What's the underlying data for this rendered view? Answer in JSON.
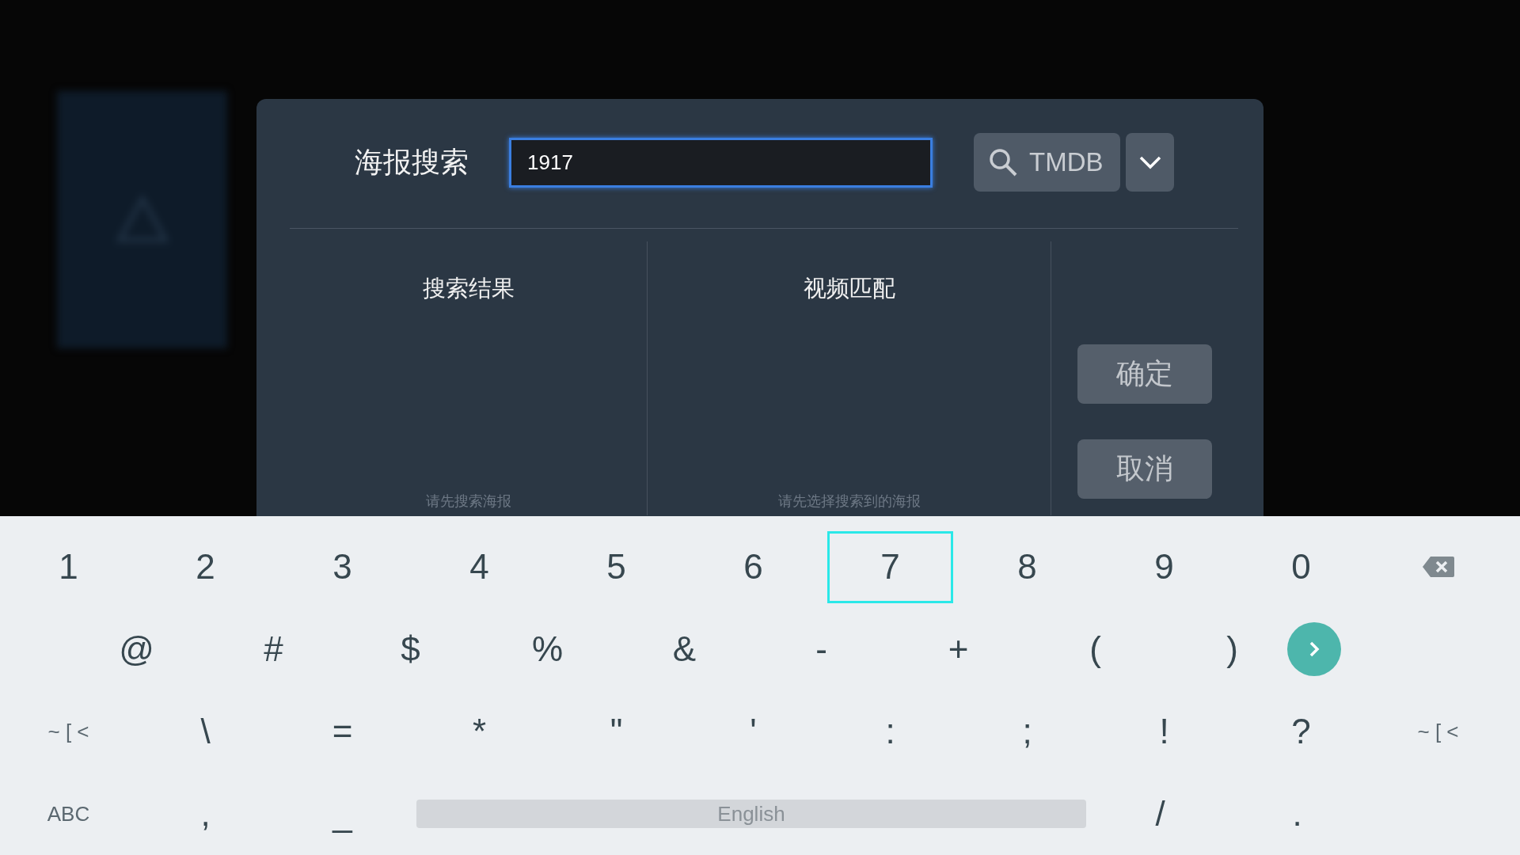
{
  "dialog": {
    "title": "海报搜索",
    "search": {
      "value": "1917"
    },
    "source_button": {
      "label": "TMDB"
    },
    "columns": [
      {
        "heading": "搜索结果",
        "hint": "请先搜索海报"
      },
      {
        "heading": "视频匹配",
        "hint": "请先选择搜索到的海报"
      }
    ],
    "buttons": [
      "确定",
      "取消"
    ]
  },
  "keyboard": {
    "rows": [
      {
        "keys": [
          {
            "kind": "char",
            "label": "1",
            "selected": false
          },
          {
            "kind": "char",
            "label": "2",
            "selected": false
          },
          {
            "kind": "char",
            "label": "3",
            "selected": false
          },
          {
            "kind": "char",
            "label": "4",
            "selected": false
          },
          {
            "kind": "char",
            "label": "5",
            "selected": false
          },
          {
            "kind": "char",
            "label": "6",
            "selected": false
          },
          {
            "kind": "char",
            "label": "7",
            "selected": true
          },
          {
            "kind": "char",
            "label": "8",
            "selected": false
          },
          {
            "kind": "char",
            "label": "9",
            "selected": false
          },
          {
            "kind": "char",
            "label": "0",
            "selected": false
          },
          {
            "kind": "backspace",
            "selected": false
          }
        ]
      },
      {
        "keys": [
          {
            "kind": "char",
            "label": "@",
            "selected": false
          },
          {
            "kind": "char",
            "label": "#",
            "selected": false
          },
          {
            "kind": "char",
            "label": "$",
            "selected": false
          },
          {
            "kind": "char",
            "label": "%",
            "selected": false
          },
          {
            "kind": "char",
            "label": "&",
            "selected": false
          },
          {
            "kind": "char",
            "label": "-",
            "selected": false
          },
          {
            "kind": "char",
            "label": "+",
            "selected": false
          },
          {
            "kind": "char",
            "label": "(",
            "selected": false
          },
          {
            "kind": "char",
            "label": ")",
            "selected": false
          },
          {
            "kind": "go",
            "selected": false
          }
        ]
      },
      {
        "keys": [
          {
            "kind": "mode",
            "label": "~ [ <",
            "selected": false
          },
          {
            "kind": "char",
            "label": "\\",
            "selected": false
          },
          {
            "kind": "char",
            "label": "=",
            "selected": false
          },
          {
            "kind": "char",
            "label": "*",
            "selected": false
          },
          {
            "kind": "char",
            "label": "\"",
            "selected": false
          },
          {
            "kind": "char",
            "label": "'",
            "selected": false
          },
          {
            "kind": "char",
            "label": ":",
            "selected": false
          },
          {
            "kind": "char",
            "label": ";",
            "selected": false
          },
          {
            "kind": "char",
            "label": "!",
            "selected": false
          },
          {
            "kind": "char",
            "label": "?",
            "selected": false
          },
          {
            "kind": "mode",
            "label": "~ [ <",
            "selected": false
          }
        ]
      },
      {
        "keys": [
          {
            "kind": "mode",
            "label": "ABC",
            "selected": false
          },
          {
            "kind": "char",
            "label": ",",
            "selected": false
          },
          {
            "kind": "char",
            "label": "_",
            "selected": false
          },
          {
            "kind": "space",
            "label": "English",
            "selected": false
          },
          {
            "kind": "char",
            "label": "/",
            "selected": false
          },
          {
            "kind": "char",
            "label": ".",
            "selected": false
          }
        ]
      }
    ]
  }
}
